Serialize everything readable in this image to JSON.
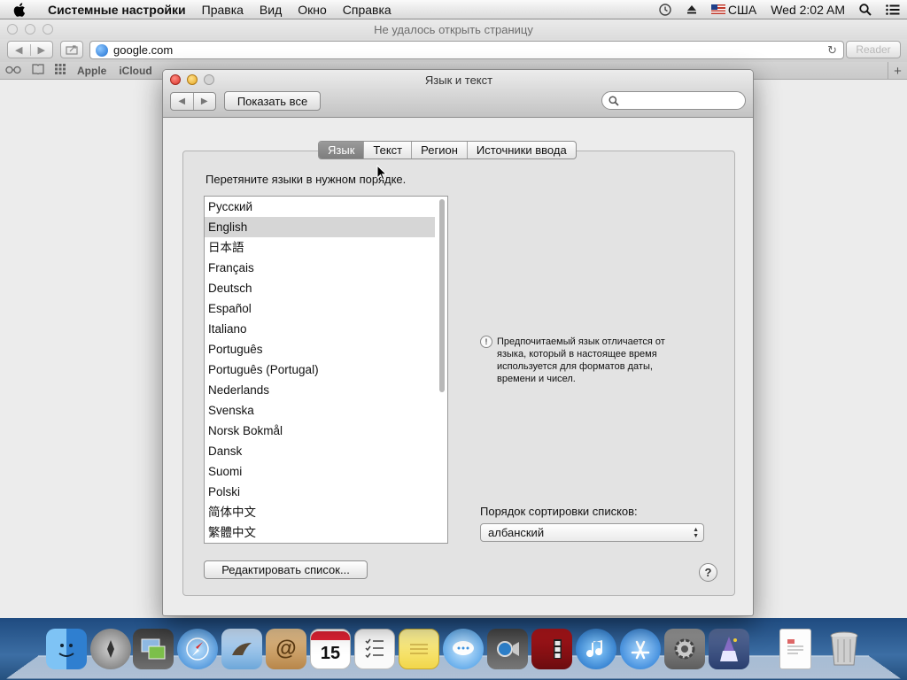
{
  "menubar": {
    "app_name": "Системные настройки",
    "items": [
      "Правка",
      "Вид",
      "Окно",
      "Справка"
    ],
    "input_source": "США",
    "clock": "Wed 2:02 AM"
  },
  "browser": {
    "title": "Не удалось открыть страницу",
    "url": "google.com",
    "reader_label": "Reader",
    "bookmarks": [
      "Apple",
      "iCloud"
    ]
  },
  "prefs": {
    "title": "Язык и текст",
    "show_all_label": "Показать все",
    "search_placeholder": "",
    "tabs": [
      {
        "label": "Язык",
        "selected": true
      },
      {
        "label": "Текст",
        "selected": false
      },
      {
        "label": "Регион",
        "selected": false
      },
      {
        "label": "Источники ввода",
        "selected": false
      }
    ],
    "drag_hint": "Перетяните языки в нужном порядке.",
    "languages": [
      "Русский",
      "English",
      "日本語",
      "Français",
      "Deutsch",
      "Español",
      "Italiano",
      "Português",
      "Português (Portugal)",
      "Nederlands",
      "Svenska",
      "Norsk Bokmål",
      "Dansk",
      "Suomi",
      "Polski",
      "简体中文",
      "繁體中文"
    ],
    "selected_language": "English",
    "info_text": "Предпочитаемый язык отличается от языка, который в настоящее время используется для форматов даты, времени и чисел.",
    "sort_label": "Порядок сортировки списков:",
    "sort_value": "албанский",
    "edit_list_label": "Редактировать список...",
    "help_label": "?"
  },
  "dock": {
    "apps": [
      "finder",
      "launchpad",
      "image-capture",
      "safari",
      "mail",
      "contacts",
      "calendar",
      "reminders",
      "notes",
      "messages",
      "facetime",
      "photo-booth",
      "itunes",
      "app-store",
      "system-preferences",
      "wizard",
      "document",
      "trash"
    ],
    "calendar_day": "15"
  },
  "colors": {
    "desktop": "#2a5a8f",
    "selected_tab": "#8a8a8a",
    "selected_row": "#d6d6d6"
  }
}
